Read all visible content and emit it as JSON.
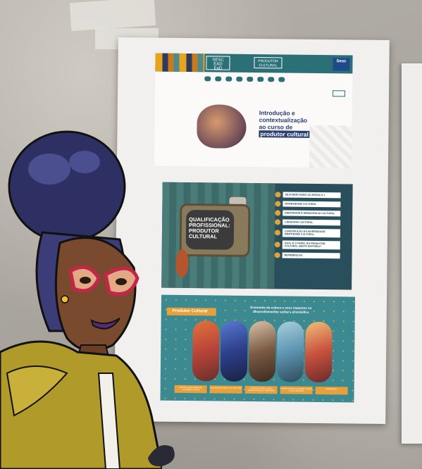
{
  "slide1": {
    "brand_logo": [
      "SESC",
      "EAD",
      "EaD"
    ],
    "course_badge": [
      "PRODUTOR",
      "CULTURAL"
    ],
    "sesc_mark": "Sesc",
    "title_line1": "Introdução e",
    "title_line2": "contextualização",
    "title_line3": "ao curso de",
    "title_highlight": "produtor cultural"
  },
  "slide2": {
    "tv_title": "QUALIFICAÇÃO PROFISSIONAL: PRODUTOR CULTURAL",
    "menu": [
      "SEJA BEM-VINDO (A) MÓDULO 1",
      "DIVERSIDADE CULTURAL",
      "IDENTIDADE E DEMOCRACIA CULTURAL",
      "CIDADANIA CULTURAL",
      "CONSTRUÇÃO DA DIVERSIDADE: IDENTIDADE CULTURAL",
      "QUAL É O PAPEL DO PRODUTOR CULTURAL NESTA HISTÓRIA?",
      "REFERÊNCIAS"
    ]
  },
  "slide3": {
    "tab": "Produtor Cultural",
    "heading": "Economia da cultura e seus impactos no desenvolvimento social e econômico",
    "captions": [
      "Cultura e desenvolvimento econômico e social",
      "Economia da cultura: um novo olhar",
      "Economia criativa e seus desdobramentos e dinamismo",
      "Setores criativos: principais cadeias e suas atividades",
      "Referências"
    ],
    "photo_colors": [
      "#b8443a",
      "#2c3f8a",
      "#7a5a44",
      "#5d94b0",
      "#c9523e"
    ]
  }
}
